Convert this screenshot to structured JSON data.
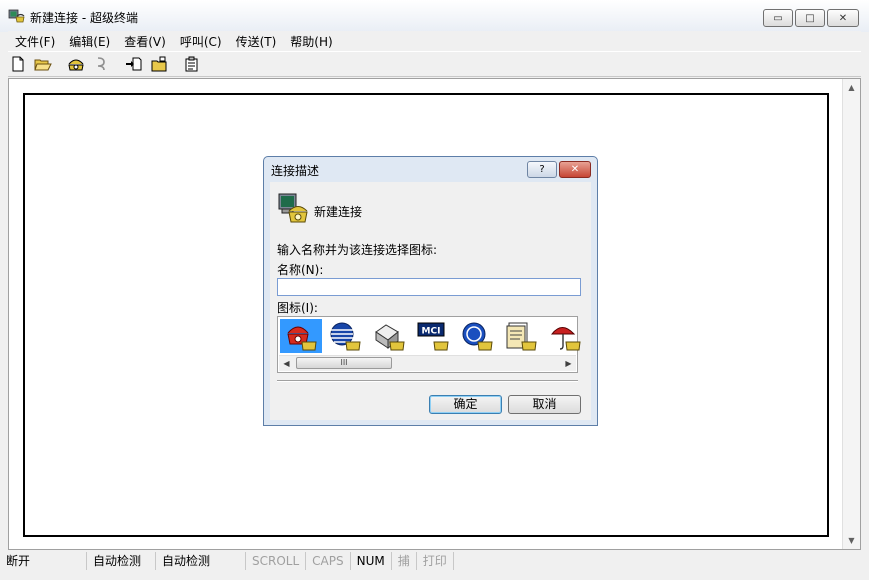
{
  "window": {
    "title": "新建连接 - 超级终端",
    "controls": {
      "minimize": "▭",
      "maximize": "□",
      "close": "✕"
    }
  },
  "menu": [
    "文件(F)",
    "编辑(E)",
    "查看(V)",
    "呼叫(C)",
    "传送(T)",
    "帮助(H)"
  ],
  "toolbar": {
    "icons": [
      "new-file-icon",
      "open-folder-icon",
      "dial-phone-icon",
      "disconnect-icon",
      "send-file-icon",
      "receive-file-icon",
      "properties-icon"
    ]
  },
  "dialog": {
    "title": "连接描述",
    "help": "?",
    "close": "✕",
    "heading": "新建连接",
    "prompt": "输入名称并为该连接选择图标:",
    "name_label": "名称(N):",
    "name_value": "",
    "icon_label": "图标(I):",
    "ok": "确定",
    "cancel": "取消",
    "scroll_thumb": "III",
    "scroll_left": "◀",
    "scroll_right": "▶",
    "icon_choices": [
      "red-phone-icon",
      "globe-phone-icon",
      "fax-phone-icon",
      "mci-phone-icon",
      "ge-phone-icon",
      "document-phone-icon",
      "umbrella-phone-icon"
    ],
    "selected_icon": 0
  },
  "scrollbar": {
    "up": "▲",
    "down": "▼"
  },
  "status": [
    {
      "text": "断开",
      "dim": false
    },
    {
      "text": "自动检测",
      "dim": false
    },
    {
      "text": "自动检测",
      "dim": false
    },
    {
      "text": "SCROLL",
      "dim": true
    },
    {
      "text": "CAPS",
      "dim": true
    },
    {
      "text": "NUM",
      "dim": false
    },
    {
      "text": "捕",
      "dim": true
    },
    {
      "text": "打印",
      "dim": true
    }
  ],
  "colors": {
    "selection": "#3399ff",
    "dialog_frame": "#dfe8f3",
    "close_red": "#c64534"
  }
}
